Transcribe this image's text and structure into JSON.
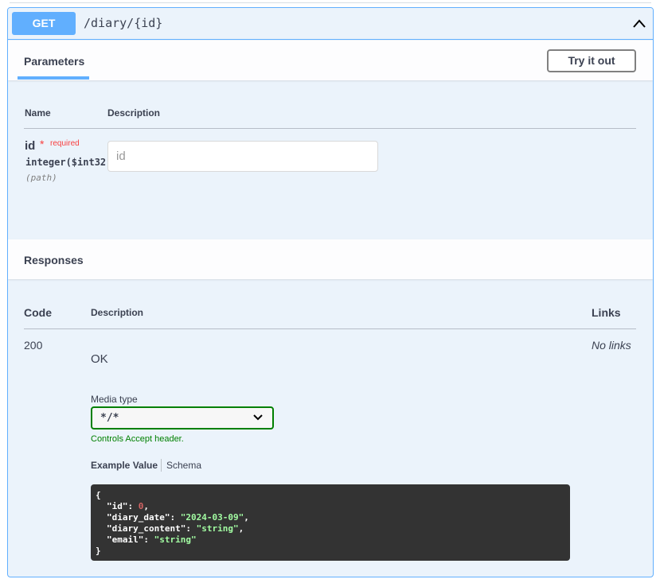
{
  "endpoint": {
    "method": "GET",
    "path": "/diary/{id}"
  },
  "parameters_section": {
    "tab_label": "Parameters",
    "try_button": "Try it out",
    "columns": [
      "Name",
      "Description"
    ],
    "param": {
      "name": "id",
      "star": "*",
      "required_label": "required",
      "type": "integer($int32)",
      "location": "(path)",
      "placeholder": "id"
    }
  },
  "responses_section": {
    "title": "Responses",
    "columns": {
      "code": "Code",
      "description": "Description",
      "links": "Links"
    },
    "row": {
      "code": "200",
      "description": "OK",
      "links": "No links"
    },
    "media_type_label": "Media type",
    "media_type_value": "*/*",
    "controls_text": "Controls Accept header.",
    "example_tab": "Example Value",
    "schema_tab": "Schema",
    "example": {
      "open": "{",
      "close": "}",
      "lines": [
        {
          "key": "\"id\"",
          "value": "0",
          "kind": "num",
          "sep": ","
        },
        {
          "key": "\"diary_date\"",
          "value": "\"2024-03-09\"",
          "kind": "str",
          "sep": ","
        },
        {
          "key": "\"diary_content\"",
          "value": "\"string\"",
          "kind": "str",
          "sep": ","
        },
        {
          "key": "\"email\"",
          "value": "\"string\"",
          "kind": "str",
          "sep": ""
        }
      ]
    }
  },
  "colors": {
    "get_blue": "#61affe",
    "background": "#ebf3fb",
    "required_red": "#f93e3e",
    "accept_green": "#008000",
    "code_bg": "#333333"
  },
  "icons": {
    "collapse": "chevron-up-icon",
    "select": "chevron-down-icon"
  }
}
